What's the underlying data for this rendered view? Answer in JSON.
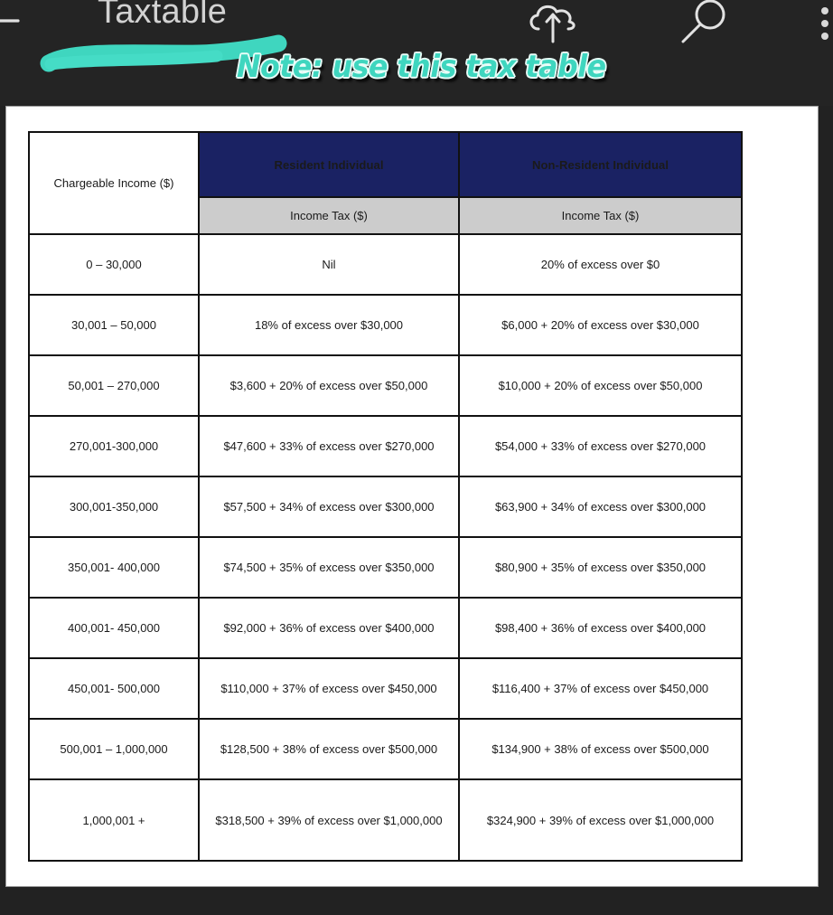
{
  "appbar": {
    "title": "Taxtable",
    "back_icon": "back-arrow-icon",
    "cloud_upload_icon": "cloud-upload-icon",
    "search_icon": "search-icon",
    "overflow_icon": "overflow-menu-icon"
  },
  "annotation": {
    "note_text": "Note: use this tax table",
    "note_color": "#3fd6bf",
    "highlight_color": "#3fd6bf"
  },
  "colors": {
    "appbar_bg": "#242424",
    "page_bg": "#ffffff",
    "header_navy": "#1a2263",
    "subheader_gray": "#cccccc",
    "border": "#111111",
    "title_text": "#d2d2d2"
  },
  "table": {
    "corner_header": "Chargeable Income ($)",
    "group_headers": [
      "Resident Individual",
      "Non-Resident Individual"
    ],
    "sub_headers": [
      "Income Tax ($)",
      "Income Tax ($)"
    ],
    "rows": [
      {
        "range": "0 – 30,000",
        "resident": "Nil",
        "non_resident": "20% of excess over $0"
      },
      {
        "range": "30,001 – 50,000",
        "resident": "18% of excess over $30,000",
        "non_resident": "$6,000 + 20% of excess over $30,000"
      },
      {
        "range": "50,001 – 270,000",
        "resident": "$3,600 + 20% of excess over $50,000",
        "non_resident": "$10,000 + 20% of excess over $50,000"
      },
      {
        "range": "270,001-300,000",
        "resident": "$47,600 + 33% of excess over $270,000",
        "non_resident": "$54,000 + 33% of excess over $270,000"
      },
      {
        "range": "300,001-350,000",
        "resident": "$57,500 + 34% of excess over $300,000",
        "non_resident": "$63,900 + 34% of excess over $300,000"
      },
      {
        "range": "350,001- 400,000",
        "resident": "$74,500 + 35% of excess over $350,000",
        "non_resident": "$80,900 + 35% of excess over $350,000"
      },
      {
        "range": "400,001- 450,000",
        "resident": "$92,000 + 36% of excess over $400,000",
        "non_resident": "$98,400 + 36% of excess over $400,000"
      },
      {
        "range": "450,001- 500,000",
        "resident": "$110,000 + 37% of excess over $450,000",
        "non_resident": "$116,400 + 37% of excess over $450,000"
      },
      {
        "range": "500,001 – 1,000,000",
        "resident": "$128,500 + 38% of excess over $500,000",
        "non_resident": "$134,900 + 38% of excess over $500,000"
      },
      {
        "range": "1,000,001 +",
        "resident": "$318,500 + 39% of excess over $1,000,000",
        "non_resident": "$324,900 + 39% of excess over $1,000,000"
      }
    ]
  }
}
